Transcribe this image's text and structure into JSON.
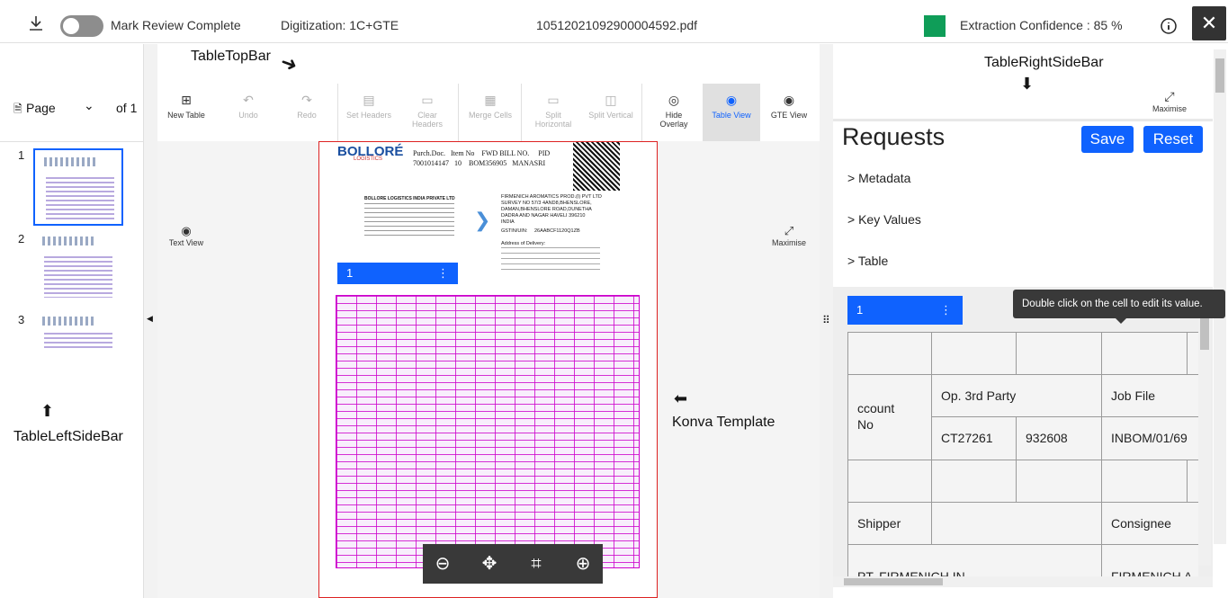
{
  "header": {
    "review_label": "Mark Review Complete",
    "digitization": "Digitization: 1C+GTE",
    "filename": "10512021092900004592.pdf",
    "confidence": "Extraction Confidence : 85 %",
    "confidence_color": "#0f9d58",
    "close": "✕"
  },
  "left": {
    "page_label": "Page",
    "of_label": "of 1",
    "thumbs": [
      "1",
      "2",
      "3"
    ]
  },
  "toolbar": {
    "new_table": "New Table",
    "undo": "Undo",
    "redo": "Redo",
    "set_headers": "Set Headers",
    "clear_headers": "Clear Headers",
    "merge_cells": "Merge Cells",
    "split_horizontal": "Split Horizontal",
    "split_vertical": "Split Vertical",
    "hide_overlay": "Hide Overlay",
    "table_view": "Table View",
    "gte_view": "GTE View"
  },
  "center": {
    "text_view": "Text View",
    "maximise": "Maximise",
    "table_label": "1",
    "doc": {
      "company": "BOLLORÉ",
      "sub": "LOGISTICS",
      "purch": "Purch.Doc.   Item No    FWD BILL NO.     PID",
      "purch_vals": "7001014147   10    BOM356905   MANASRI",
      "addr1": "BOLLORE LOGISTICS INDIA PRIVATE LTD",
      "addr2": "FIRMENICH AROMATICS PROD.(I) PVT LTD",
      "addr3": "SURVEY NO 57/3 4AND8,BHENSLORE,",
      "addr4": "DAMAN,BHENSLORE ROAD,DUNETHA",
      "addr5": "DADRA AND NAGAR HAVELI 396210",
      "addr6": "INDIA",
      "gstin": "GSTIN/UIN:     26AABCF1120Q1ZB",
      "delivery": "Address of Delivery:"
    }
  },
  "annotations": {
    "top": "TableTopBar",
    "right": "TableRightSideBar",
    "left": "TableLeftSideBar",
    "konva": "Konva Template"
  },
  "right": {
    "maximise": "Maximise",
    "title": "Requests",
    "save": "Save",
    "reset": "Reset",
    "sections": [
      "Metadata",
      "Key Values",
      "Table"
    ],
    "table_label": "1",
    "tooltip": "Double click on the cell to edit its value.",
    "cells": {
      "account": "ccount\nNo",
      "op": "Op. 3rd Party",
      "job": "Job File",
      "ct": "CT27261",
      "num": "932608",
      "inbom": "INBOM/01/69",
      "shipper": "Shipper",
      "consignee": "Consignee",
      "pt": "PT. FIRMENICH IN",
      "firm": "FIRMENICH A"
    }
  }
}
